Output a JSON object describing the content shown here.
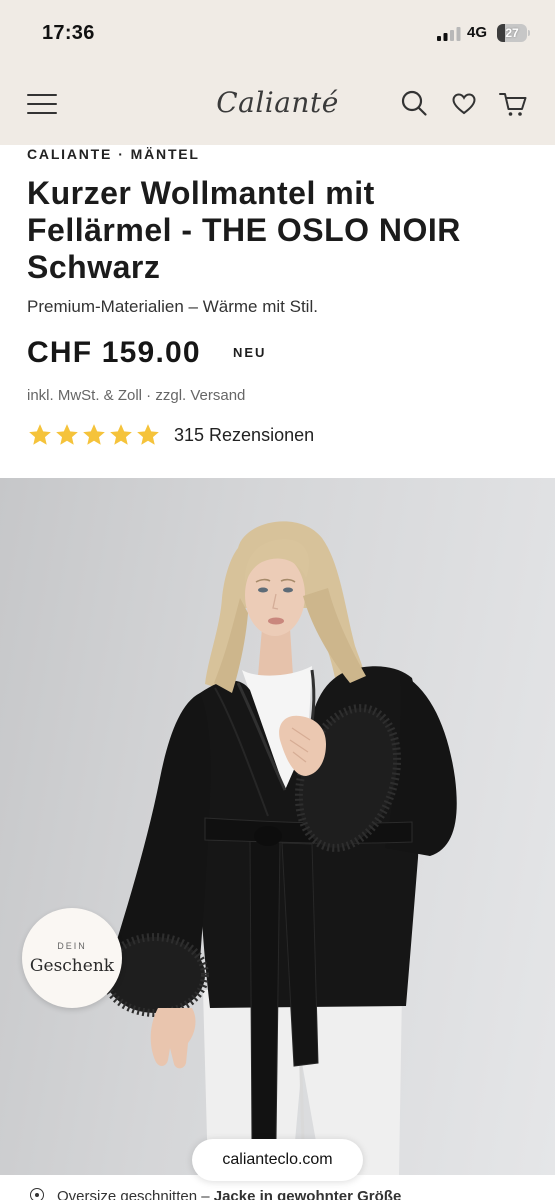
{
  "status_bar": {
    "time": "17:36",
    "network": "4G",
    "battery": "27"
  },
  "header": {
    "logo": "Calianté",
    "icons": [
      "menu-icon",
      "search-icon",
      "heart-icon",
      "cart-icon"
    ]
  },
  "product": {
    "breadcrumb": {
      "items": [
        "CALIANTE",
        "MÄNTEL"
      ],
      "separator": "·"
    },
    "title": "Kurzer Wollmantel mit Fellärmel - THE OSLO NOIR Schwarz",
    "tagline": "Premium-Materialien – Wärme mit Stil.",
    "price": "CHF 159.00",
    "badge": "NEU",
    "tax_note": "inkl. MwSt. & Zoll · zzgl. Versand",
    "rating": 5,
    "reviews": "315 Rezensionen"
  },
  "gallery": {
    "gift_badge": {
      "line1": "DEIN",
      "line2": "Geschenk"
    }
  },
  "feature": {
    "icon": "info-icon",
    "text": "Oversize geschnitten – ",
    "emphasis": "Jacke in gewohnter Größe"
  },
  "browser": {
    "url": "calianteclo.com"
  },
  "colors": {
    "header_bg": "#f0ebe5",
    "star": "#f5c33b",
    "text": "#1c1c1c"
  }
}
